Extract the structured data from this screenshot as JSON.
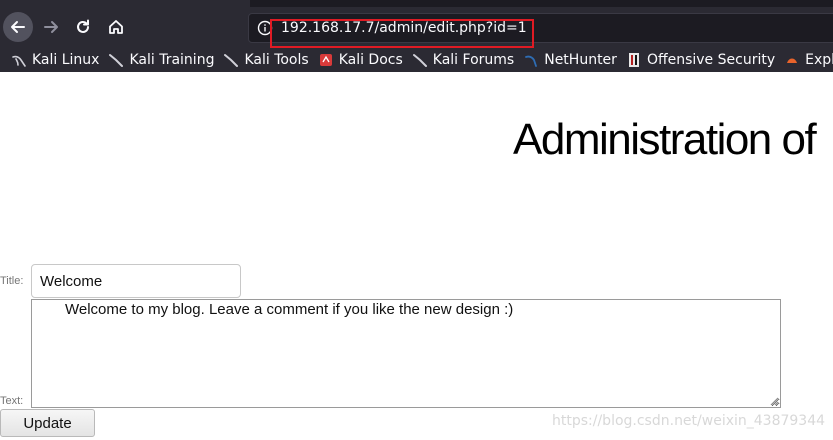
{
  "browser": {
    "url": "192.168.17.7/admin/edit.php?id=1",
    "highlight_color": "#e01b24",
    "bookmarks": [
      {
        "label": "Kali Linux",
        "icon": "kali-dragon-icon"
      },
      {
        "label": "Kali Training",
        "icon": "kali-dragon-icon"
      },
      {
        "label": "Kali Tools",
        "icon": "kali-dragon-icon"
      },
      {
        "label": "Kali Docs",
        "icon": "kali-docs-icon"
      },
      {
        "label": "Kali Forums",
        "icon": "kali-dragon-icon"
      },
      {
        "label": "NetHunter",
        "icon": "nethunter-icon"
      },
      {
        "label": "Offensive Security",
        "icon": "offsec-icon"
      },
      {
        "label": "Exploi",
        "icon": "exploit-db-icon"
      }
    ]
  },
  "page": {
    "heading": "Administration of",
    "title_label": "Title:",
    "title_value": "Welcome",
    "text_label": "Text:",
    "text_value": "Welcome to my blog. Leave a comment if you like the new design :)",
    "update_label": "Update"
  },
  "watermark": "https://blog.csdn.net/weixin_43879344"
}
